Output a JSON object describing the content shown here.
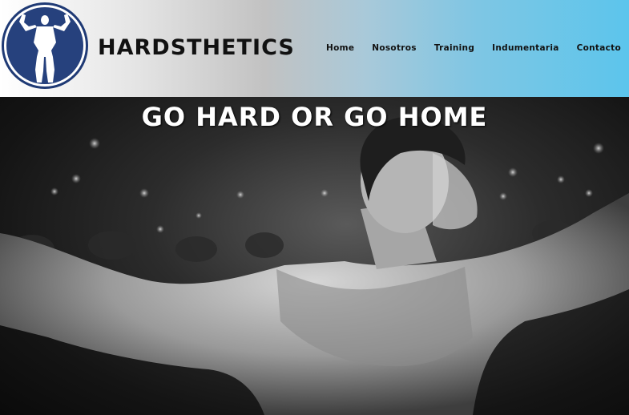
{
  "header": {
    "brand_name": "HARDSTHETICS",
    "logo_icon": "bodybuilder-silhouette-icon",
    "colors": {
      "gradient_start": "#ffffff",
      "gradient_end": "#5cc5ec",
      "logo_ring": "#1f3a75",
      "logo_fill": "#26417d"
    }
  },
  "nav": {
    "items": [
      {
        "label": "Home"
      },
      {
        "label": "Nosotros"
      },
      {
        "label": "Training"
      },
      {
        "label": "Indumentaria"
      },
      {
        "label": "Contacto"
      }
    ]
  },
  "hero": {
    "title": "GO HARD OR GO HOME",
    "image": "black-and-white-bodybuilder-photo"
  }
}
